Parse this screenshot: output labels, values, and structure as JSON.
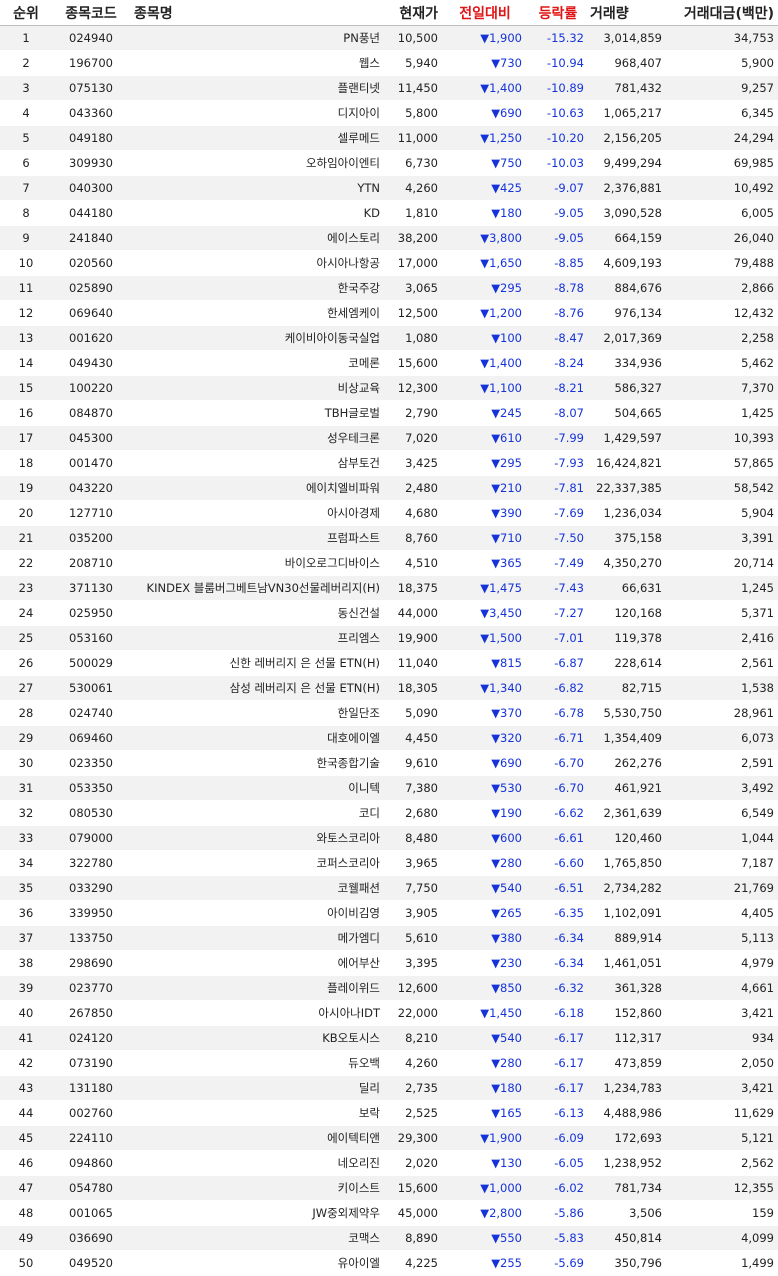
{
  "header": {
    "rank": "순위",
    "code": "종목코드",
    "name": "종목명",
    "price": "현재가",
    "change": "전일대비",
    "rate": "등락률",
    "volume": "거래량",
    "amount": "거래대금(백만)"
  },
  "colors": {
    "header_highlight": "#e01414",
    "down": "#1533d9",
    "row_stripe": "#f2f2f2"
  },
  "rows": [
    [
      "1",
      "024940",
      "PN풍년",
      "10,500",
      "▼1,900",
      "-15.32",
      "3,014,859",
      "34,753"
    ],
    [
      "2",
      "196700",
      "웹스",
      "5,940",
      "▼730",
      "-10.94",
      "968,407",
      "5,900"
    ],
    [
      "3",
      "075130",
      "플랜티넷",
      "11,450",
      "▼1,400",
      "-10.89",
      "781,432",
      "9,257"
    ],
    [
      "4",
      "043360",
      "디지아이",
      "5,800",
      "▼690",
      "-10.63",
      "1,065,217",
      "6,345"
    ],
    [
      "5",
      "049180",
      "셀루메드",
      "11,000",
      "▼1,250",
      "-10.20",
      "2,156,205",
      "24,294"
    ],
    [
      "6",
      "309930",
      "오하임아이엔티",
      "6,730",
      "▼750",
      "-10.03",
      "9,499,294",
      "69,985"
    ],
    [
      "7",
      "040300",
      "YTN",
      "4,260",
      "▼425",
      "-9.07",
      "2,376,881",
      "10,492"
    ],
    [
      "8",
      "044180",
      "KD",
      "1,810",
      "▼180",
      "-9.05",
      "3,090,528",
      "6,005"
    ],
    [
      "9",
      "241840",
      "에이스토리",
      "38,200",
      "▼3,800",
      "-9.05",
      "664,159",
      "26,040"
    ],
    [
      "10",
      "020560",
      "아시아나항공",
      "17,000",
      "▼1,650",
      "-8.85",
      "4,609,193",
      "79,488"
    ],
    [
      "11",
      "025890",
      "한국주강",
      "3,065",
      "▼295",
      "-8.78",
      "884,676",
      "2,866"
    ],
    [
      "12",
      "069640",
      "한세엠케이",
      "12,500",
      "▼1,200",
      "-8.76",
      "976,134",
      "12,432"
    ],
    [
      "13",
      "001620",
      "케이비아이동국실업",
      "1,080",
      "▼100",
      "-8.47",
      "2,017,369",
      "2,258"
    ],
    [
      "14",
      "049430",
      "코메론",
      "15,600",
      "▼1,400",
      "-8.24",
      "334,936",
      "5,462"
    ],
    [
      "15",
      "100220",
      "비상교육",
      "12,300",
      "▼1,100",
      "-8.21",
      "586,327",
      "7,370"
    ],
    [
      "16",
      "084870",
      "TBH글로벌",
      "2,790",
      "▼245",
      "-8.07",
      "504,665",
      "1,425"
    ],
    [
      "17",
      "045300",
      "성우테크론",
      "7,020",
      "▼610",
      "-7.99",
      "1,429,597",
      "10,393"
    ],
    [
      "18",
      "001470",
      "삼부토건",
      "3,425",
      "▼295",
      "-7.93",
      "16,424,821",
      "57,865"
    ],
    [
      "19",
      "043220",
      "에이치엘비파워",
      "2,480",
      "▼210",
      "-7.81",
      "22,337,385",
      "58,542"
    ],
    [
      "20",
      "127710",
      "아시아경제",
      "4,680",
      "▼390",
      "-7.69",
      "1,236,034",
      "5,904"
    ],
    [
      "21",
      "035200",
      "프럼파스트",
      "8,760",
      "▼710",
      "-7.50",
      "375,158",
      "3,391"
    ],
    [
      "22",
      "208710",
      "바이오로그디바이스",
      "4,510",
      "▼365",
      "-7.49",
      "4,350,270",
      "20,714"
    ],
    [
      "23",
      "371130",
      "KINDEX 블룸버그베트남VN30선물레버리지(H)",
      "18,375",
      "▼1,475",
      "-7.43",
      "66,631",
      "1,245"
    ],
    [
      "24",
      "025950",
      "동신건설",
      "44,000",
      "▼3,450",
      "-7.27",
      "120,168",
      "5,371"
    ],
    [
      "25",
      "053160",
      "프리엠스",
      "19,900",
      "▼1,500",
      "-7.01",
      "119,378",
      "2,416"
    ],
    [
      "26",
      "500029",
      "신한 레버리지 은 선물 ETN(H)",
      "11,040",
      "▼815",
      "-6.87",
      "228,614",
      "2,561"
    ],
    [
      "27",
      "530061",
      "삼성 레버리지 은 선물 ETN(H)",
      "18,305",
      "▼1,340",
      "-6.82",
      "82,715",
      "1,538"
    ],
    [
      "28",
      "024740",
      "한일단조",
      "5,090",
      "▼370",
      "-6.78",
      "5,530,750",
      "28,961"
    ],
    [
      "29",
      "069460",
      "대호에이엘",
      "4,450",
      "▼320",
      "-6.71",
      "1,354,409",
      "6,073"
    ],
    [
      "30",
      "023350",
      "한국종합기술",
      "9,610",
      "▼690",
      "-6.70",
      "262,276",
      "2,591"
    ],
    [
      "31",
      "053350",
      "이니텍",
      "7,380",
      "▼530",
      "-6.70",
      "461,921",
      "3,492"
    ],
    [
      "32",
      "080530",
      "코디",
      "2,680",
      "▼190",
      "-6.62",
      "2,361,639",
      "6,549"
    ],
    [
      "33",
      "079000",
      "와토스코리아",
      "8,480",
      "▼600",
      "-6.61",
      "120,460",
      "1,044"
    ],
    [
      "34",
      "322780",
      "코퍼스코리아",
      "3,965",
      "▼280",
      "-6.60",
      "1,765,850",
      "7,187"
    ],
    [
      "35",
      "033290",
      "코웰패션",
      "7,750",
      "▼540",
      "-6.51",
      "2,734,282",
      "21,769"
    ],
    [
      "36",
      "339950",
      "아이비김영",
      "3,905",
      "▼265",
      "-6.35",
      "1,102,091",
      "4,405"
    ],
    [
      "37",
      "133750",
      "메가엠디",
      "5,610",
      "▼380",
      "-6.34",
      "889,914",
      "5,113"
    ],
    [
      "38",
      "298690",
      "에어부산",
      "3,395",
      "▼230",
      "-6.34",
      "1,461,051",
      "4,979"
    ],
    [
      "39",
      "023770",
      "플레이위드",
      "12,600",
      "▼850",
      "-6.32",
      "361,328",
      "4,661"
    ],
    [
      "40",
      "267850",
      "아시아나IDT",
      "22,000",
      "▼1,450",
      "-6.18",
      "152,860",
      "3,421"
    ],
    [
      "41",
      "024120",
      "KB오토시스",
      "8,210",
      "▼540",
      "-6.17",
      "112,317",
      "934"
    ],
    [
      "42",
      "073190",
      "듀오백",
      "4,260",
      "▼280",
      "-6.17",
      "473,859",
      "2,050"
    ],
    [
      "43",
      "131180",
      "딜리",
      "2,735",
      "▼180",
      "-6.17",
      "1,234,783",
      "3,421"
    ],
    [
      "44",
      "002760",
      "보락",
      "2,525",
      "▼165",
      "-6.13",
      "4,488,986",
      "11,629"
    ],
    [
      "45",
      "224110",
      "에이텍티앤",
      "29,300",
      "▼1,900",
      "-6.09",
      "172,693",
      "5,121"
    ],
    [
      "46",
      "094860",
      "네오리진",
      "2,020",
      "▼130",
      "-6.05",
      "1,238,952",
      "2,562"
    ],
    [
      "47",
      "054780",
      "키이스트",
      "15,600",
      "▼1,000",
      "-6.02",
      "781,734",
      "12,355"
    ],
    [
      "48",
      "001065",
      "JW중외제약우",
      "45,000",
      "▼2,800",
      "-5.86",
      "3,506",
      "159"
    ],
    [
      "49",
      "036690",
      "코맥스",
      "8,890",
      "▼550",
      "-5.83",
      "450,814",
      "4,099"
    ],
    [
      "50",
      "049520",
      "유아이엘",
      "4,225",
      "▼255",
      "-5.69",
      "350,796",
      "1,499"
    ]
  ]
}
